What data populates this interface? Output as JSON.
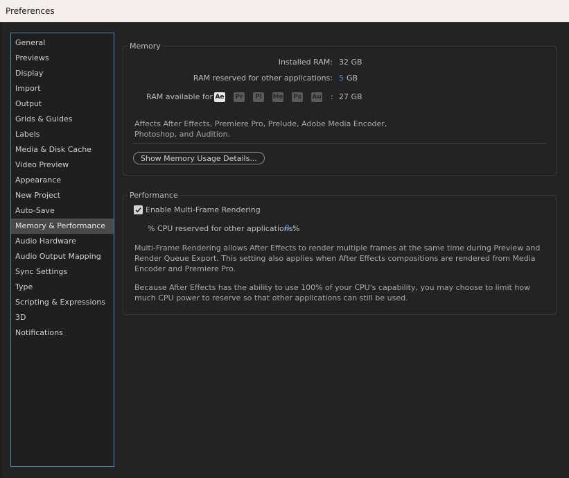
{
  "window": {
    "title": "Preferences"
  },
  "sidebar": {
    "items": [
      {
        "label": "General"
      },
      {
        "label": "Previews"
      },
      {
        "label": "Display"
      },
      {
        "label": "Import"
      },
      {
        "label": "Output"
      },
      {
        "label": "Grids & Guides"
      },
      {
        "label": "Labels"
      },
      {
        "label": "Media & Disk Cache"
      },
      {
        "label": "Video Preview"
      },
      {
        "label": "Appearance"
      },
      {
        "label": "New Project"
      },
      {
        "label": "Auto-Save"
      },
      {
        "label": "Memory & Performance",
        "selected": true
      },
      {
        "label": "Audio Hardware"
      },
      {
        "label": "Audio Output Mapping"
      },
      {
        "label": "Sync Settings"
      },
      {
        "label": "Type"
      },
      {
        "label": "Scripting & Expressions"
      },
      {
        "label": "3D"
      },
      {
        "label": "Notifications"
      }
    ]
  },
  "memory": {
    "title": "Memory",
    "installed_ram_label": "Installed RAM:",
    "installed_ram_value": "32 GB",
    "reserved_label": "RAM reserved for other applications:",
    "reserved_value": "5",
    "reserved_unit": "GB",
    "available_label": "RAM available for",
    "apps": [
      "Ae",
      "Pr",
      "Pl",
      "Me",
      "Ps",
      "Au"
    ],
    "available_sep": ":",
    "available_value": "27 GB",
    "affects_line1": "Affects After Effects, Premiere Pro, Prelude, Adobe Media Encoder,",
    "affects_line2": "Photoshop, and Audition.",
    "details_button": "Show Memory Usage Details..."
  },
  "performance": {
    "title": "Performance",
    "mfr_label": "Enable Multi-Frame Rendering",
    "mfr_checked": true,
    "cpu_label": "% CPU reserved for other applications:",
    "cpu_value": "8",
    "cpu_unit": "%",
    "para1_line1": "Multi-Frame Rendering allows After Effects to render multiple frames at the same time during Preview and",
    "para1_line2": "Render Queue Export. This setting also applies when After Effects compositions are rendered from Media",
    "para1_line3": "Encoder and Premiere Pro.",
    "para2_line1": "Because After Effects has the ability to use 100% of your CPU's capability, you may choose to limit how",
    "para2_line2": "much CPU power to reserve so that other applications can still be used."
  },
  "colors": {
    "accent": "#4c8fe0",
    "background": "#232323",
    "selected_item": "#494949",
    "titlebar": "#f4eeee"
  },
  "icons": {
    "checkbox": "check-icon"
  }
}
